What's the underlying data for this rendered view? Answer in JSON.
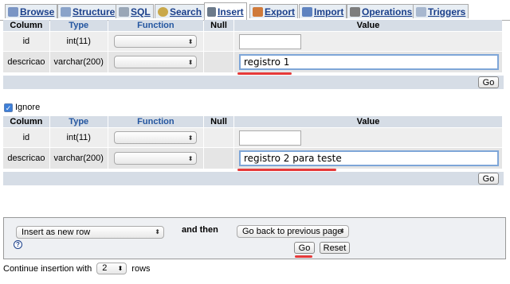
{
  "tabs": [
    {
      "label": "Browse",
      "icon": "browse-icon",
      "active": false
    },
    {
      "label": "Structure",
      "icon": "structure-icon",
      "active": false
    },
    {
      "label": "SQL",
      "icon": "sql-icon",
      "active": false
    },
    {
      "label": "Search",
      "icon": "search-icon",
      "active": false
    },
    {
      "label": "Insert",
      "icon": "insert-icon",
      "active": true
    },
    {
      "label": "Export",
      "icon": "export-icon",
      "active": false
    },
    {
      "label": "Import",
      "icon": "import-icon",
      "active": false
    },
    {
      "label": "Operations",
      "icon": "operations-icon",
      "active": false
    },
    {
      "label": "Triggers",
      "icon": "triggers-icon",
      "active": false
    }
  ],
  "headers": {
    "column": "Column",
    "type": "Type",
    "function": "Function",
    "null": "Null",
    "value": "Value"
  },
  "form1": {
    "rows": [
      {
        "column": "id",
        "type": "int(11)",
        "function": "",
        "value": ""
      },
      {
        "column": "descricao",
        "type": "varchar(200)",
        "function": "",
        "value": "registro 1"
      }
    ],
    "go_label": "Go"
  },
  "ignore": {
    "label": "Ignore",
    "checked": true
  },
  "form2": {
    "rows": [
      {
        "column": "id",
        "type": "int(11)",
        "function": "",
        "value": ""
      },
      {
        "column": "descricao",
        "type": "varchar(200)",
        "function": "",
        "value": "registro 2 para teste"
      }
    ],
    "go_label": "Go"
  },
  "options": {
    "insert_mode": "Insert as new row",
    "and_then_label": "and then",
    "after_action": "Go back to previous page",
    "help_icon": "help-icon",
    "go_label": "Go",
    "reset_label": "Reset"
  },
  "continue": {
    "prefix": "Continue insertion with",
    "count": "2",
    "suffix": "rows"
  },
  "colors": {
    "tab_text": "#1a3f8a",
    "header_bg": "#d6dde6",
    "cell_bg": "#e5e5e5",
    "highlight": "#e63a3a",
    "focus_border": "#7ea6d8"
  }
}
